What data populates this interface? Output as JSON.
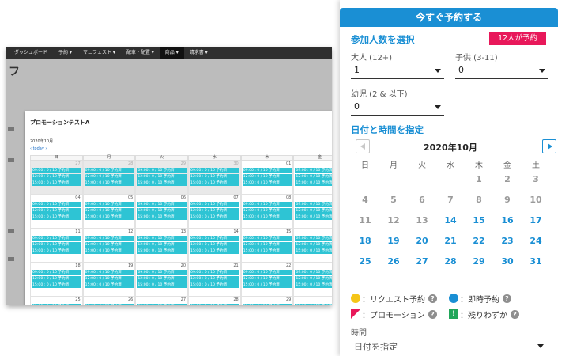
{
  "background_window": {
    "nav_items": [
      "ダッシュボード",
      "予約 ▾",
      "マニフェスト ▾",
      "配車・配置 ▾",
      "商品 ▾",
      "請求書 ▾"
    ],
    "nav_active_index": 4,
    "page_title_fragment": "フ",
    "modal": {
      "title": "プロモーションテストA",
      "month": "2020年10月",
      "nav_prev": "‹",
      "nav_today": "today",
      "nav_next": "›",
      "weekday_headers": [
        "日",
        "月",
        "火",
        "水",
        "木",
        "金"
      ],
      "weeks": [
        [
          {
            "day": "27",
            "off": true
          },
          {
            "day": "28",
            "off": true
          },
          {
            "day": "29",
            "off": true
          },
          {
            "day": "30",
            "off": true
          },
          {
            "day": "01",
            "off": false
          },
          {
            "day": "02",
            "off": false
          }
        ],
        [
          {
            "day": "04",
            "off": false
          },
          {
            "day": "05",
            "off": false
          },
          {
            "day": "06",
            "off": false
          },
          {
            "day": "07",
            "off": false
          },
          {
            "day": "08",
            "off": false
          },
          {
            "day": "09",
            "off": false
          }
        ],
        [
          {
            "day": "11",
            "off": false
          },
          {
            "day": "12",
            "off": false
          },
          {
            "day": "13",
            "off": false
          },
          {
            "day": "14",
            "off": false
          },
          {
            "day": "15",
            "off": false
          },
          {
            "day": "16",
            "off": false
          }
        ],
        [
          {
            "day": "18",
            "off": false
          },
          {
            "day": "19",
            "off": false
          },
          {
            "day": "20",
            "off": false
          },
          {
            "day": "21",
            "off": false
          },
          {
            "day": "22",
            "off": false
          },
          {
            "day": "23",
            "off": false
          }
        ],
        [
          {
            "day": "25",
            "off": false
          },
          {
            "day": "26",
            "off": false
          },
          {
            "day": "27",
            "off": false
          },
          {
            "day": "28",
            "off": false
          },
          {
            "day": "29",
            "off": false
          },
          {
            "day": "30",
            "off": false
          }
        ]
      ],
      "slots": [
        "09:00 : 0 / 10 予約済",
        "12:00 : 0 / 10 予約済",
        "15:00 : 0 / 10 予約済"
      ]
    }
  },
  "panel": {
    "book_button": "今すぐ予約する",
    "participants_heading": "参加人数を選択",
    "badge": "12人が予約",
    "adult_label": "大人 (12+)",
    "adult_value": "1",
    "child_label": "子供 (3-11)",
    "child_value": "0",
    "infant_label": "幼児 (2 & 以下)",
    "infant_value": "0",
    "date_heading": "日付と時間を指定",
    "month_label": "2020年10月",
    "weekdays": [
      "日",
      "月",
      "火",
      "水",
      "木",
      "金",
      "土"
    ],
    "days": [
      {
        "d": "",
        "s": "blank"
      },
      {
        "d": "",
        "s": "blank"
      },
      {
        "d": "",
        "s": "blank"
      },
      {
        "d": "",
        "s": "blank"
      },
      {
        "d": "1",
        "s": "dis"
      },
      {
        "d": "2",
        "s": "dis"
      },
      {
        "d": "3",
        "s": "dis"
      },
      {
        "d": "4",
        "s": "dis"
      },
      {
        "d": "5",
        "s": "dis"
      },
      {
        "d": "6",
        "s": "dis"
      },
      {
        "d": "7",
        "s": "dis"
      },
      {
        "d": "8",
        "s": "dis"
      },
      {
        "d": "9",
        "s": "dis"
      },
      {
        "d": "10",
        "s": "dis"
      },
      {
        "d": "11",
        "s": "dis"
      },
      {
        "d": "12",
        "s": "dis"
      },
      {
        "d": "13",
        "s": "dis"
      },
      {
        "d": "14",
        "s": "avail"
      },
      {
        "d": "15",
        "s": "avail"
      },
      {
        "d": "16",
        "s": "avail"
      },
      {
        "d": "17",
        "s": "avail"
      },
      {
        "d": "18",
        "s": "avail"
      },
      {
        "d": "19",
        "s": "avail"
      },
      {
        "d": "20",
        "s": "avail"
      },
      {
        "d": "21",
        "s": "avail"
      },
      {
        "d": "22",
        "s": "avail"
      },
      {
        "d": "23",
        "s": "avail"
      },
      {
        "d": "24",
        "s": "avail"
      },
      {
        "d": "25",
        "s": "avail"
      },
      {
        "d": "26",
        "s": "avail"
      },
      {
        "d": "27",
        "s": "avail"
      },
      {
        "d": "28",
        "s": "avail"
      },
      {
        "d": "29",
        "s": "avail"
      },
      {
        "d": "30",
        "s": "avail"
      },
      {
        "d": "31",
        "s": "avail"
      }
    ],
    "legend": {
      "request": "：リクエスト予約",
      "instant": "：即時予約",
      "promotion": "：プロモーション",
      "few_left": "：残りわずか",
      "help": "?",
      "few_left_mark": "!"
    },
    "time_label": "時間",
    "time_placeholder": "日付を指定"
  },
  "colors": {
    "primary": "#1a8fd4",
    "badge": "#e8185a",
    "request": "#f5c518",
    "instant": "#1a8fd4",
    "promotion": "#e8185a",
    "few_left": "#21a65a",
    "slot": "#2ec4d4"
  }
}
